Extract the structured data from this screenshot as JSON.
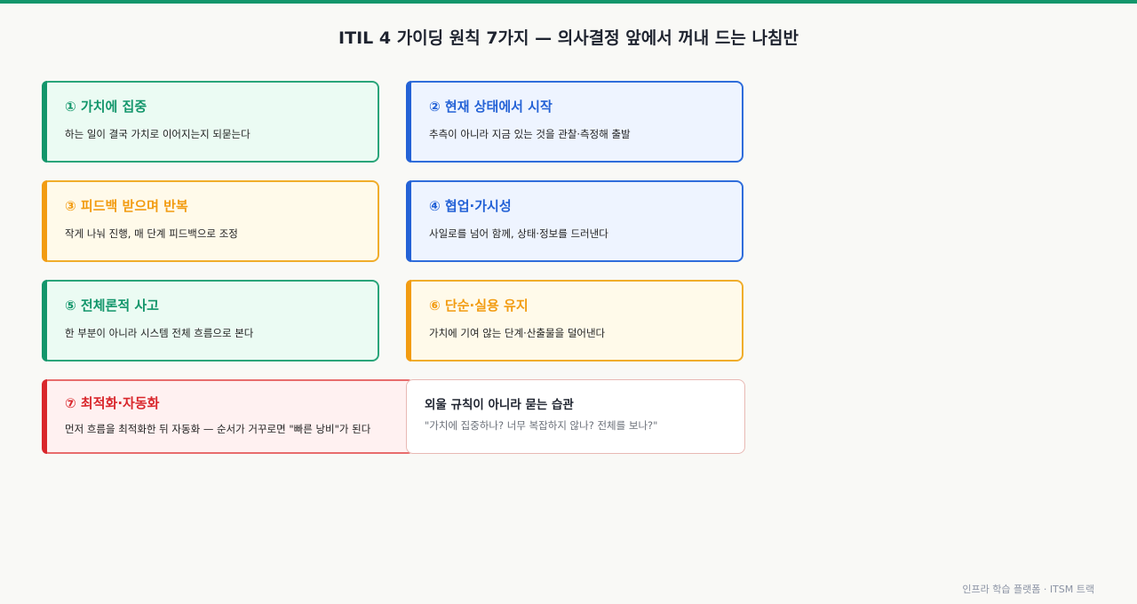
{
  "title": "ITIL 4 가이딩 원칙 7가지 — 의사결정 앞에서 꺼내 드는 나침반",
  "principles": [
    {
      "heading": "① 가치에 집중",
      "desc": "하는 일이 결국 가치로 이어지는지 되묻는다",
      "color": "#13966b"
    },
    {
      "heading": "② 현재 상태에서 시작",
      "desc": "추측이 아니라 지금 있는 것을 관찰·측정해 출발",
      "color": "#2462d6"
    },
    {
      "heading": "③ 피드백 받으며 반복",
      "desc": "작게 나눠 진행, 매 단계 피드백으로 조정",
      "color": "#f29c12"
    },
    {
      "heading": "④ 협업·가시성",
      "desc": "사일로를 넘어 함께, 상태·정보를 드러낸다",
      "color": "#2462d6"
    },
    {
      "heading": "⑤ 전체론적 사고",
      "desc": "한 부분이 아니라 시스템 전체 흐름으로 본다",
      "color": "#13966b"
    },
    {
      "heading": "⑥ 단순·실용 유지",
      "desc": "가치에 기여 않는 단계·산출물을 덜어낸다",
      "color": "#f29c12"
    },
    {
      "heading": "⑦ 최적화·자동화",
      "desc": "먼저 흐름을 최적화한 뒤 자동화 — 순서가 거꾸로면 \"빠른 낭비\"가 된다",
      "color": "#d9272c"
    }
  ],
  "habit": {
    "title": "외울 규칙이 아니라 묻는 습관",
    "quote": "\"가치에 집중하나? 너무 복잡하지 않나? 전체를 보나?\""
  },
  "footer": "인프라 학습 플랫폼 · ITSM 트랙"
}
